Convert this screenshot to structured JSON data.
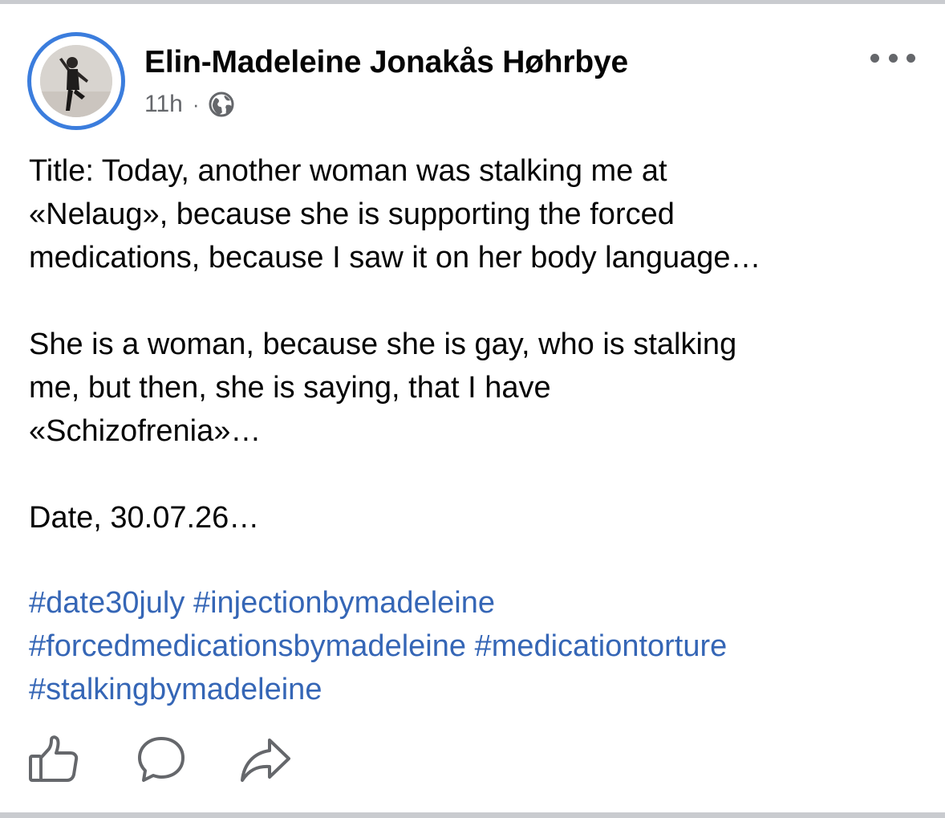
{
  "post": {
    "author": "Elin-Madeleine Jonakås Høhrbye",
    "time": "11h",
    "separator": "·",
    "audience_icon": "globe-icon",
    "more_icon": "more-options-icon",
    "paragraphs": [
      {
        "lines": [
          "Title: Today, another woman was stalking me at",
          "«Nelaug», because she is supporting the forced",
          "medications, because I saw it on her body language…"
        ]
      },
      {
        "lines": [
          "She is a woman, because she is gay, who is stalking",
          "me, but then, she is saying, that I have",
          "«Schizofrenia»…"
        ]
      },
      {
        "lines": [
          "Date, 30.07.26…"
        ]
      }
    ],
    "hashtags": [
      "#date30july",
      "#injectionbymadeleine",
      "#forcedmedicationsbymadeleine",
      "#medicationtorture",
      "#stalkingbymadeleine"
    ]
  },
  "actions": [
    {
      "icon": "like-icon"
    },
    {
      "icon": "comment-icon"
    },
    {
      "icon": "share-icon"
    }
  ],
  "colors": {
    "link": "#3566b6",
    "secondary_text": "#65676b",
    "avatar_ring": "#3b7ddd"
  }
}
